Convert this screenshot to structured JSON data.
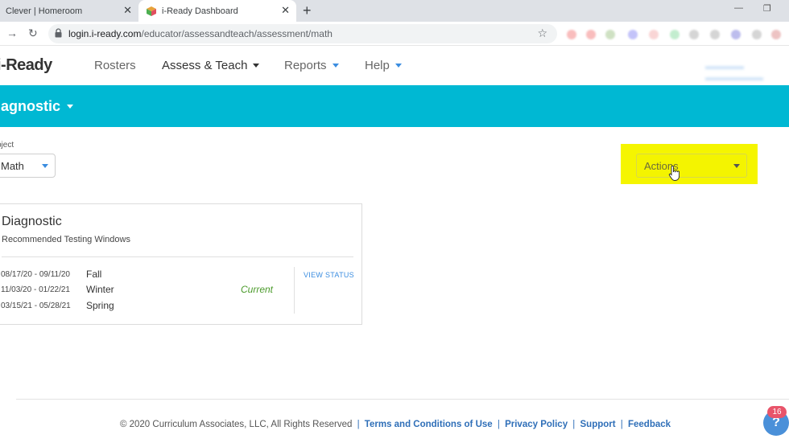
{
  "browser": {
    "tabs": [
      {
        "title": "Clever | Homeroom",
        "active": false
      },
      {
        "title": "i-Ready Dashboard",
        "active": true
      }
    ],
    "new_tab_icon": "plus-icon",
    "url_host": "login.i-ready.com",
    "url_path": "/educator/assessandteach/assessment/math"
  },
  "app": {
    "logo": "i-Ready",
    "nav": {
      "rosters": "Rosters",
      "assess_teach": "Assess & Teach",
      "reports": "Reports",
      "help": "Help"
    }
  },
  "band": {
    "title": "iagnostic"
  },
  "subject": {
    "label": "bject",
    "value": "Math"
  },
  "actions": {
    "label": "Actions"
  },
  "card": {
    "title": "Diagnostic",
    "subtitle": "Recommended Testing Windows",
    "windows": [
      {
        "dates": "08/17/20  -  09/11/20",
        "season": "Fall",
        "status": ""
      },
      {
        "dates": "11/03/20  -  01/22/21",
        "season": "Winter",
        "status": "Current"
      },
      {
        "dates": "03/15/21  -  05/28/21",
        "season": "Spring",
        "status": ""
      }
    ],
    "view_status": "VIEW STATUS"
  },
  "footer": {
    "copyright": "© 2020 Curriculum Associates, LLC, All Rights Reserved",
    "terms": "Terms and Conditions of Use",
    "privacy": "Privacy Policy",
    "support": "Support",
    "feedback": "Feedback",
    "separator": "|"
  },
  "help_widget": {
    "count": "16",
    "symbol": "?"
  },
  "colors": {
    "brand_teal": "#00b8d3",
    "highlight_yellow": "#f5f500",
    "link_blue": "#2f6fb8",
    "current_green": "#4a9a2a"
  }
}
